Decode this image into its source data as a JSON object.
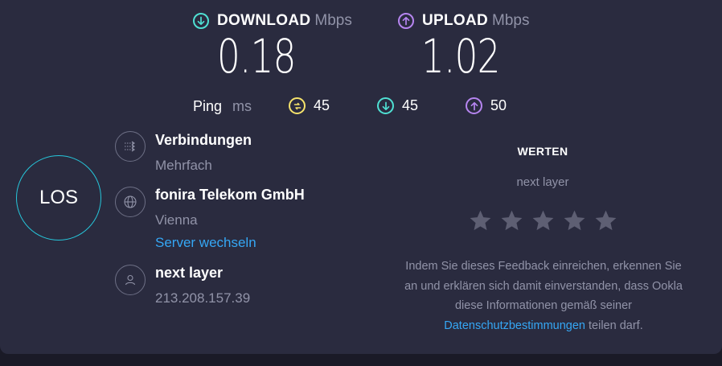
{
  "download": {
    "label": "DOWNLOAD",
    "unit": "Mbps",
    "value": "0.18",
    "color": "#4fe0d3",
    "icon": "arrow-down-circle"
  },
  "upload": {
    "label": "UPLOAD",
    "unit": "Mbps",
    "value": "1.02",
    "color": "#b685f0",
    "icon": "arrow-up-circle"
  },
  "ping": {
    "label": "Ping",
    "unit": "ms",
    "idle": {
      "value": "45",
      "color": "#f6e36b",
      "icon": "idle-latency-icon"
    },
    "download": {
      "value": "45",
      "color": "#4fe0d3",
      "icon": "arrow-down-circle"
    },
    "upload": {
      "value": "50",
      "color": "#b685f0",
      "icon": "arrow-up-circle"
    }
  },
  "go_button": {
    "label": "LOS",
    "color": "#26c6da"
  },
  "connections": {
    "title": "Verbindungen",
    "value": "Mehrfach",
    "icon": "connections-icon"
  },
  "server": {
    "title": "fonira Telekom GmbH",
    "location": "Vienna",
    "change_link": "Server wechseln",
    "icon": "globe-icon"
  },
  "provider": {
    "title": "next layer",
    "ip": "213.208.157.39",
    "icon": "user-icon"
  },
  "rating": {
    "title": "WERTEN",
    "provider": "next layer",
    "stars": 5,
    "filled": 0,
    "feedback_line1": "Indem Sie dieses Feedback einreichen, erkennen Sie",
    "feedback_line2": "an und erklären sich damit einverstanden, dass Ookla",
    "feedback_line3": "diese Informationen gemäß seiner",
    "feedback_link": "Datenschutzbestimmungen",
    "feedback_tail": " teilen darf."
  }
}
